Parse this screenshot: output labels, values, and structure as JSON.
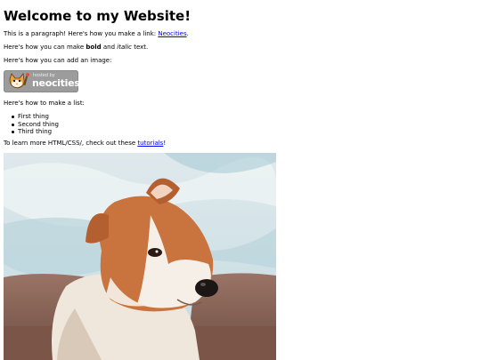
{
  "heading": "Welcome to my Website!",
  "intro": {
    "before": "This is a paragraph! Here's how you make a link: ",
    "link_text": "Neocities",
    "after": "."
  },
  "formatting": {
    "before": "Here's how you can make ",
    "bold": "bold",
    "middle": " and ",
    "italic": "italic",
    "after": " text."
  },
  "image_intro": "Here's how you can add an image:",
  "badge": {
    "small_text": "hosted by",
    "big_text": "neocities"
  },
  "list_intro": "Here's how to make a list:",
  "list_items": [
    "First thing",
    "Second thing",
    "Third thing"
  ],
  "learn_more": {
    "before": "To learn more HTML/CSS/, check out these ",
    "link_text": "tutorials",
    "after": "!"
  },
  "colors": {
    "link": "#0000ee",
    "badge_bg": "#9c9c9c",
    "sky": "#cfe0e6",
    "couch": "#8f6a5c",
    "dog_fur": "#c9733f"
  },
  "image": {
    "subject": "painting of a corgi on a couch"
  }
}
